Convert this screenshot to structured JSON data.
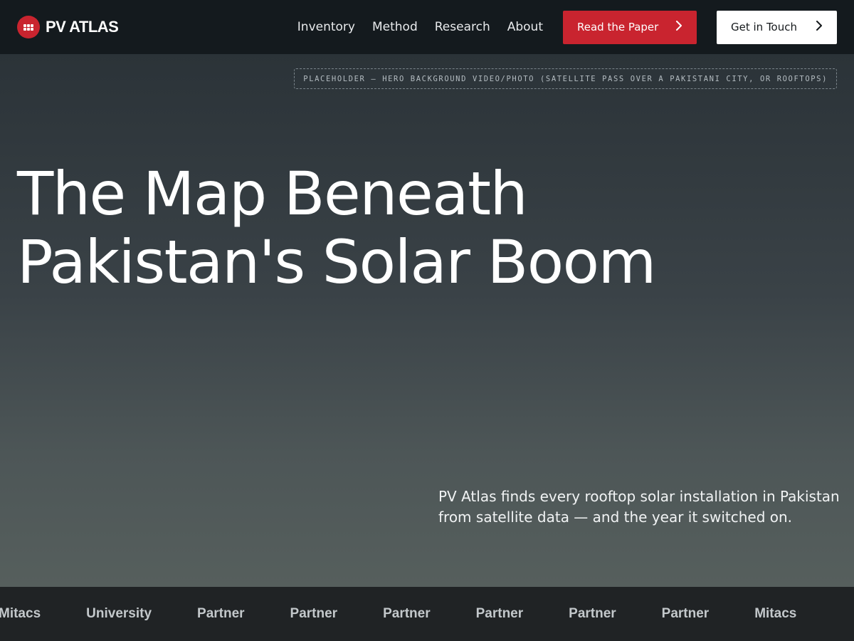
{
  "brand": {
    "name": "PV ATLAS",
    "accent_color": "#c9242f"
  },
  "nav": {
    "links": [
      {
        "label": "Inventory"
      },
      {
        "label": "Method"
      },
      {
        "label": "Research"
      },
      {
        "label": "About"
      }
    ],
    "primary_button": {
      "label": "Read the Paper",
      "icon": "chevron-right-icon"
    },
    "secondary_button": {
      "label": "Get in Touch",
      "icon": "chevron-right-icon"
    }
  },
  "hero": {
    "placeholder_text": "PLACEHOLDER — HERO BACKGROUND VIDEO/PHOTO (SATELLITE PASS OVER A PAKISTANI CITY, OR ROOFTOPS)",
    "title_lines": [
      "The Map Beneath",
      "Pakistan's Solar Boom"
    ],
    "subtitle": "PV Atlas finds every rooftop solar installation in Pakistan from satellite data — and the year it switched on."
  },
  "partners": {
    "items": [
      "Mitacs",
      "University",
      "Partner",
      "Partner",
      "Partner",
      "Partner",
      "Partner",
      "Partner",
      "Mitacs"
    ]
  }
}
